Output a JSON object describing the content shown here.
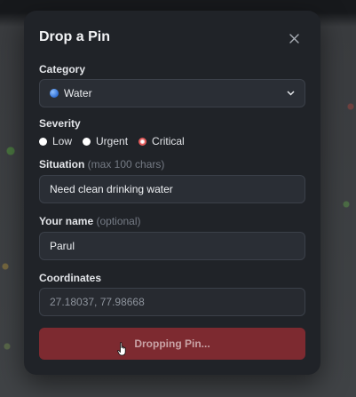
{
  "dialog": {
    "title": "Drop a Pin",
    "close_icon": "close-icon"
  },
  "category": {
    "label": "Category",
    "selected": "Water",
    "icon": "globe-icon"
  },
  "severity": {
    "label": "Severity",
    "options": [
      "Low",
      "Urgent",
      "Critical"
    ],
    "selected": "Critical"
  },
  "situation": {
    "label": "Situation",
    "hint": "(max 100 chars)",
    "value": "Need clean drinking water"
  },
  "name": {
    "label": "Your name",
    "hint": "(optional)",
    "value": "Parul"
  },
  "coordinates": {
    "label": "Coordinates",
    "value": "27.18037, 77.98668"
  },
  "submit": {
    "label": "Dropping Pin..."
  },
  "colors": {
    "accent": "#7d2a30",
    "selected_radio": "#e35b5b"
  }
}
